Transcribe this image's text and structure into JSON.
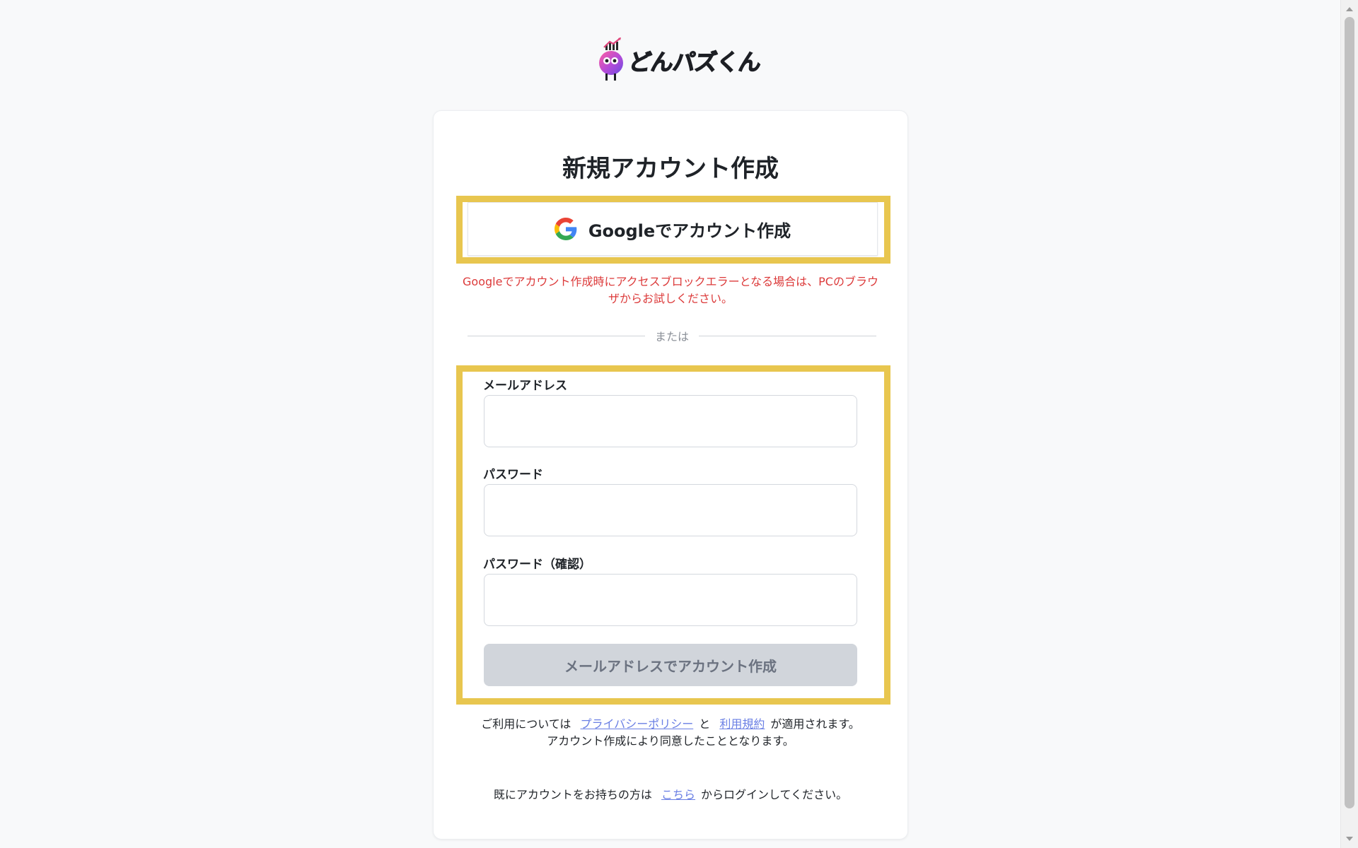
{
  "logo": {
    "text": "どんパズくん"
  },
  "card": {
    "title": "新規アカウント作成",
    "google_button": {
      "label": "Googleでアカウント作成",
      "icon": "google-g-icon"
    },
    "notice": "Googleでアカウント作成時にアクセスブロックエラーとなる場合は、PCのブラウザからお試しください。",
    "divider_text": "または",
    "fields": {
      "email_label": "メールアドレス",
      "email_value": "",
      "password_label": "パスワード",
      "password_value": "",
      "password_confirm_label": "パスワード（確認）",
      "password_confirm_value": ""
    },
    "submit_label": "メールアドレスでアカウント作成",
    "terms": {
      "prefix": "ご利用については",
      "privacy_link": "プライバシーポリシー",
      "conj": "と",
      "terms_link": "利用規約",
      "suffix": "が適用されます。",
      "line2": "アカウント作成により同意したこととなります。"
    },
    "login": {
      "prefix": "既にアカウントをお持ちの方は",
      "link": "こちら",
      "suffix": "からログインしてください。"
    }
  },
  "colors": {
    "highlight_frame": "#e8c64f",
    "notice_text": "#dc3a3a",
    "link": "#6a7fe4",
    "submit_disabled_bg": "#d1d5db",
    "page_bg": "#f8f9fa"
  }
}
